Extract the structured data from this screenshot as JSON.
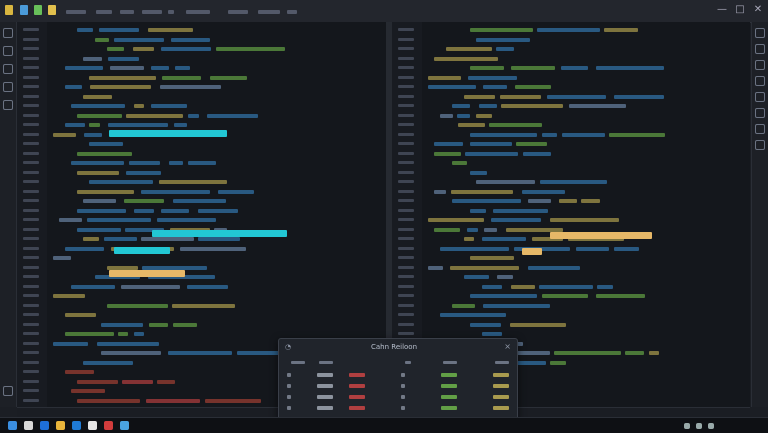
{
  "popup": {
    "title": "Cahn Reiloon",
    "close": "×",
    "icon": "◔",
    "headers": [
      "",
      "",
      "",
      "",
      "",
      ""
    ],
    "rows": [
      [
        "",
        "",
        "",
        "",
        "",
        ""
      ],
      [
        "",
        "",
        "",
        "",
        "",
        ""
      ],
      [
        "",
        "",
        "",
        "",
        "",
        ""
      ],
      [
        "",
        "",
        "",
        "",
        "",
        ""
      ]
    ]
  },
  "taskbar": {
    "clock": ""
  },
  "colors": {
    "cyan": "#22c7d4",
    "amber": "#e6b868",
    "blue": "#3b8fd6",
    "green": "#78c850",
    "red": "#e04848",
    "yellow": "#d6c15b"
  }
}
